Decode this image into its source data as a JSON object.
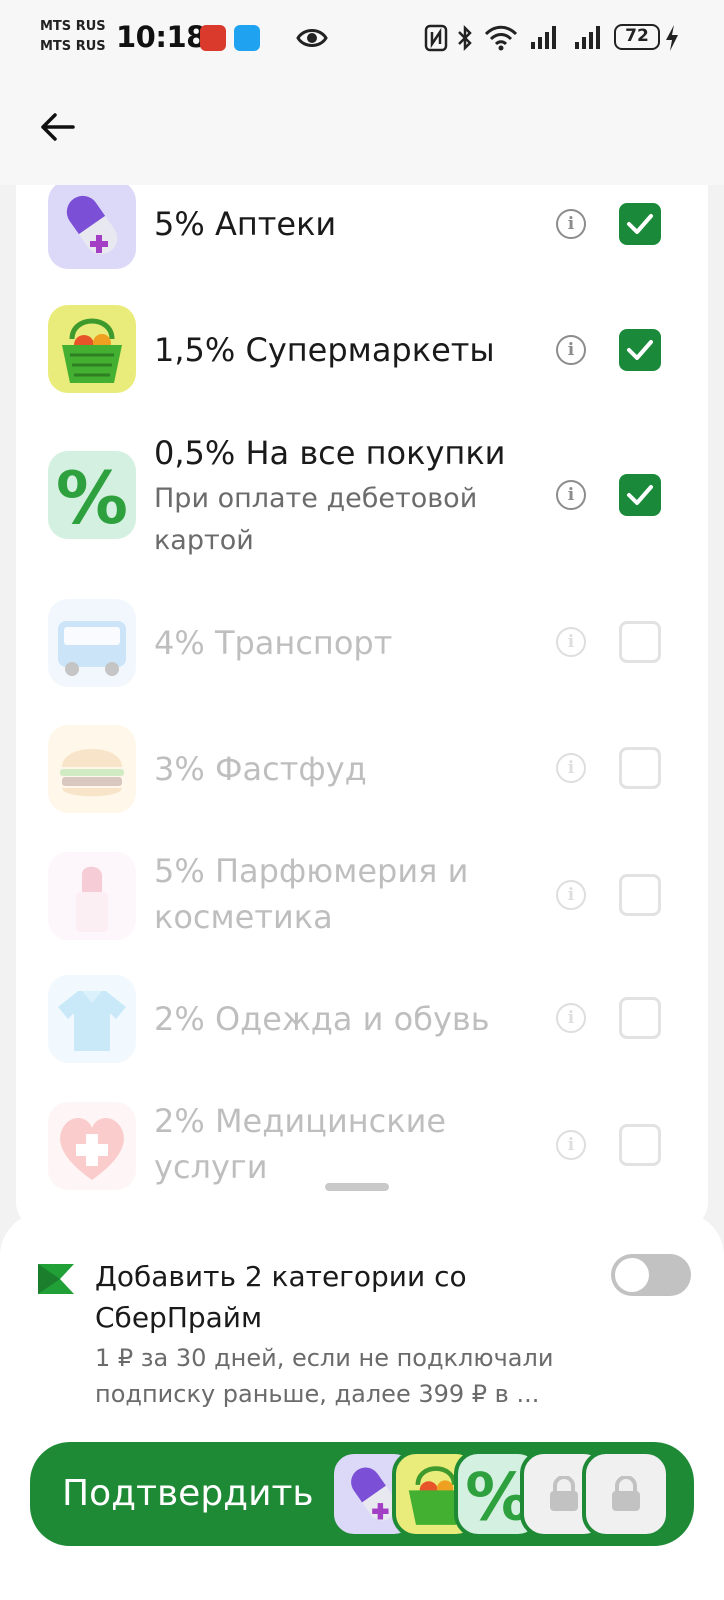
{
  "status_bar": {
    "carrier_1": "MTS RUS",
    "carrier_2": "MTS RUS",
    "time": "10:18",
    "battery": "72"
  },
  "categories": [
    {
      "title": "5% Аптеки",
      "subtitle": "",
      "checked": true,
      "enabled": true,
      "icon": "pill-capsule-icon"
    },
    {
      "title": "1,5% Супермаркеты",
      "subtitle": "",
      "checked": true,
      "enabled": true,
      "icon": "shopping-basket-icon"
    },
    {
      "title": "0,5% На все покупки",
      "subtitle": "При оплате дебетовой картой",
      "checked": true,
      "enabled": true,
      "icon": "percent-icon"
    },
    {
      "title": "4% Транспорт",
      "subtitle": "",
      "checked": false,
      "enabled": false,
      "icon": "bus-icon"
    },
    {
      "title": "3% Фастфуд",
      "subtitle": "",
      "checked": false,
      "enabled": false,
      "icon": "burger-icon"
    },
    {
      "title": "5% Парфюмерия и косметика",
      "subtitle": "",
      "checked": false,
      "enabled": false,
      "icon": "lipstick-icon"
    },
    {
      "title": "2% Одежда и обувь",
      "subtitle": "",
      "checked": false,
      "enabled": false,
      "icon": "polo-shirt-icon"
    },
    {
      "title": "2% Медицинские услуги",
      "subtitle": "",
      "checked": false,
      "enabled": false,
      "icon": "medical-heart-icon"
    }
  ],
  "prime": {
    "title": "Добавить 2 категории со СберПрайм",
    "description": "1 ₽ за 30 дней, если не подключали подписку раньше, далее 399 ₽ в ...",
    "toggle_on": false
  },
  "confirm": {
    "label": "Подтвердить"
  },
  "colors": {
    "accent": "#1f8a36",
    "checkbox": "#1a8a3a"
  }
}
